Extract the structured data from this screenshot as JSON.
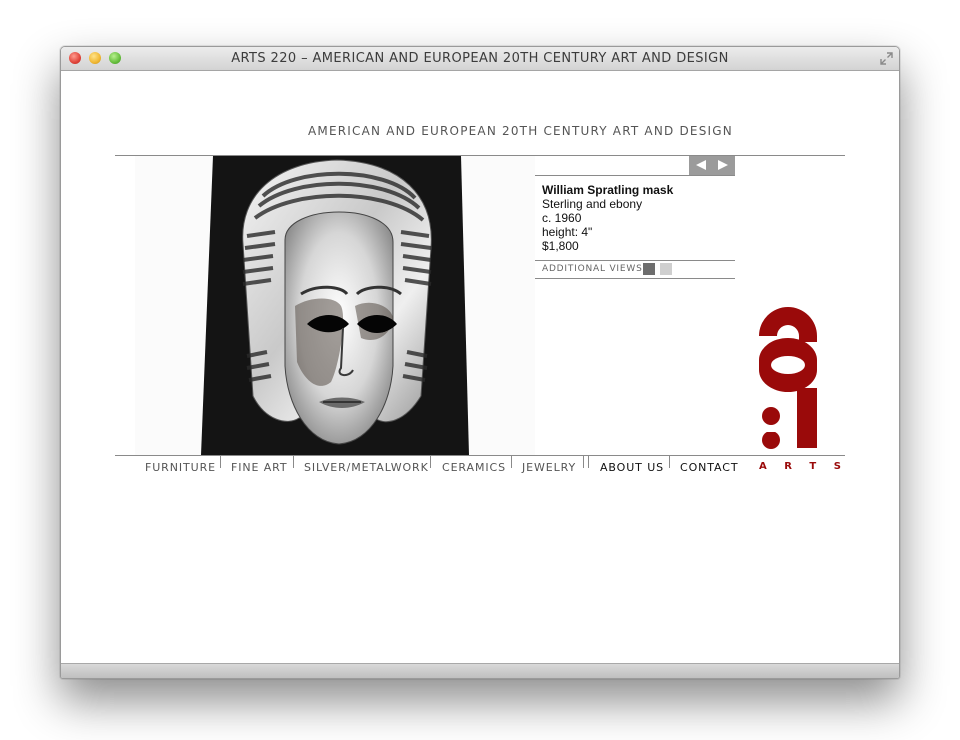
{
  "window": {
    "title": "ARTS 220 – AMERICAN AND EUROPEAN 20TH CENTURY ART AND DESIGN"
  },
  "header": {
    "tagline": "AMERICAN AND EUROPEAN 20TH CENTURY ART AND DESIGN"
  },
  "item": {
    "name": "William Spratling mask",
    "material": "Sterling and ebony",
    "date": "c. 1960",
    "height": "height: 4\"",
    "price": "$1,800"
  },
  "additional_views": {
    "label": "ADDITIONAL VIEWS"
  },
  "nav": {
    "items": [
      {
        "label": "FURNITURE"
      },
      {
        "label": "FINE ART"
      },
      {
        "label": "SILVER/METALWORK"
      },
      {
        "label": "CERAMICS"
      },
      {
        "label": "JEWELRY"
      },
      {
        "label": "ABOUT US"
      },
      {
        "label": "CONTACT"
      }
    ]
  },
  "logo": {
    "text": "ARTS 220",
    "color": "#9a0a0a"
  },
  "colors": {
    "rule": "#8a8a8a",
    "arrows_bg": "#9b9b9b",
    "thumb_active": "#6d6d6d",
    "thumb_inactive": "#cfcfcf"
  }
}
